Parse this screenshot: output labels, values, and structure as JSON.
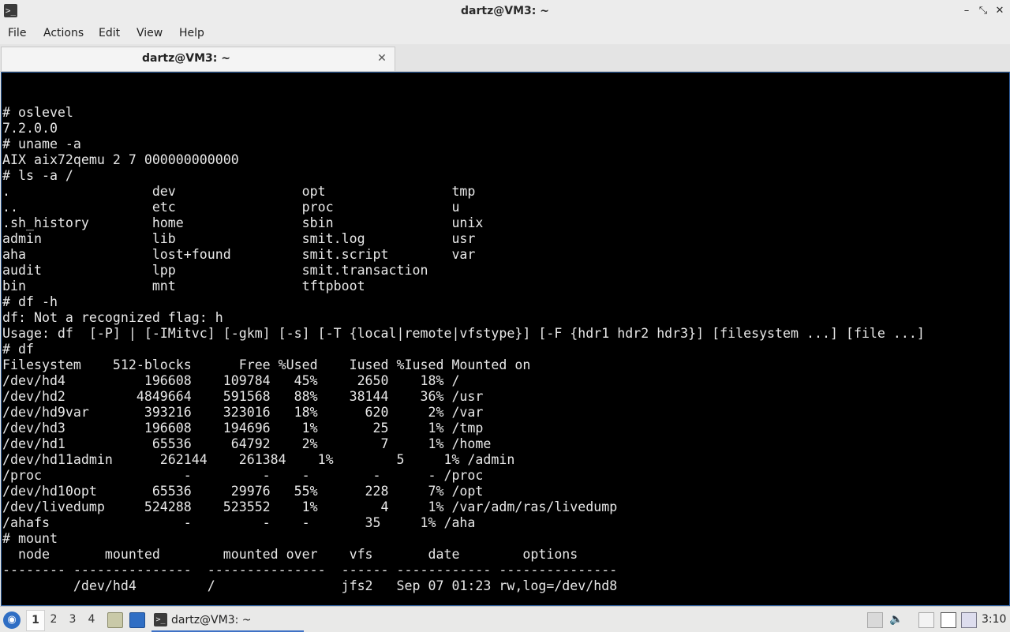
{
  "window": {
    "title": "dartz@VM3: ~",
    "controls": {
      "minimize": "–",
      "maximize": "⤡",
      "close": "✕"
    }
  },
  "menubar": {
    "items": [
      "File",
      "Actions",
      "Edit",
      "View",
      "Help"
    ]
  },
  "tabs": [
    {
      "label": "dartz@VM3: ~",
      "close": "✕"
    }
  ],
  "terminal": {
    "lines": [
      "# oslevel",
      "7.2.0.0",
      "# uname -a",
      "AIX aix72qemu 2 7 000000000000",
      "# ls -a /",
      ".                  dev                opt                tmp",
      "..                 etc                proc               u",
      ".sh_history        home               sbin               unix",
      "admin              lib                smit.log           usr",
      "aha                lost+found         smit.script        var",
      "audit              lpp                smit.transaction",
      "bin                mnt                tftpboot",
      "# df -h",
      "df: Not a recognized flag: h",
      "Usage: df  [-P] | [-IMitvc] [-gkm] [-s] [-T {local|remote|vfstype}] [-F {hdr1 hdr2 hdr3}] [filesystem ...] [file ...]",
      "# df",
      "Filesystem    512-blocks      Free %Used    Iused %Iused Mounted on",
      "/dev/hd4          196608    109784   45%     2650    18% /",
      "/dev/hd2         4849664    591568   88%    38144    36% /usr",
      "/dev/hd9var       393216    323016   18%      620     2% /var",
      "/dev/hd3          196608    194696    1%       25     1% /tmp",
      "/dev/hd1           65536     64792    2%        7     1% /home",
      "/dev/hd11admin      262144    261384    1%        5     1% /admin",
      "/proc                  -         -    -        -      - /proc",
      "/dev/hd10opt       65536     29976   55%      228     7% /opt",
      "/dev/livedump     524288    523552    1%        4     1% /var/adm/ras/livedump",
      "/ahafs                 -         -    -       35     1% /aha",
      "# mount",
      "  node       mounted        mounted over    vfs       date        options",
      "-------- ---------------  ---------------  ------ ------------ ---------------",
      "         /dev/hd4         /                jfs2   Sep 07 01:23 rw,log=/dev/hd8"
    ]
  },
  "taskbar": {
    "start_icon": "◉",
    "workspaces": [
      "1",
      "2",
      "3",
      "4"
    ],
    "active_workspace": "1",
    "task_label": "dartz@VM3: ~",
    "task_icon": ">_",
    "clock": "3:10"
  }
}
